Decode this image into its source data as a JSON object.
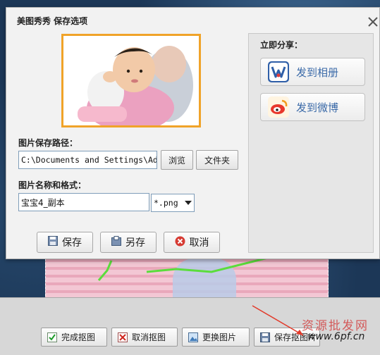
{
  "dialog": {
    "title": "美图秀秀 保存选项",
    "save_path_label": "图片保存路径：",
    "save_path_value": "C:\\Documents and Settings\\Ad",
    "browse_label": "浏览",
    "folder_label": "文件夹",
    "name_format_label": "图片名称和格式：",
    "file_name_value": "宝宝4_副本",
    "format_value": "*.png",
    "save_label": "保存",
    "save_as_label": "另存",
    "cancel_label": "取消"
  },
  "share": {
    "title": "立即分享：",
    "album_label": "发到相册",
    "weibo_label": "发到微博"
  },
  "bottom_toolbar": {
    "finish_label": "完成抠图",
    "cancel_cutout_label": "取消抠图",
    "replace_label": "更换图片",
    "save_label": "保存抠图片"
  },
  "watermark": {
    "text": "资源批发网",
    "url": "www.6pf.cn"
  },
  "colors": {
    "preview_border": "#f0a329",
    "share_text": "#3b6aa8",
    "dialog_bg": "#f2f2f2"
  }
}
